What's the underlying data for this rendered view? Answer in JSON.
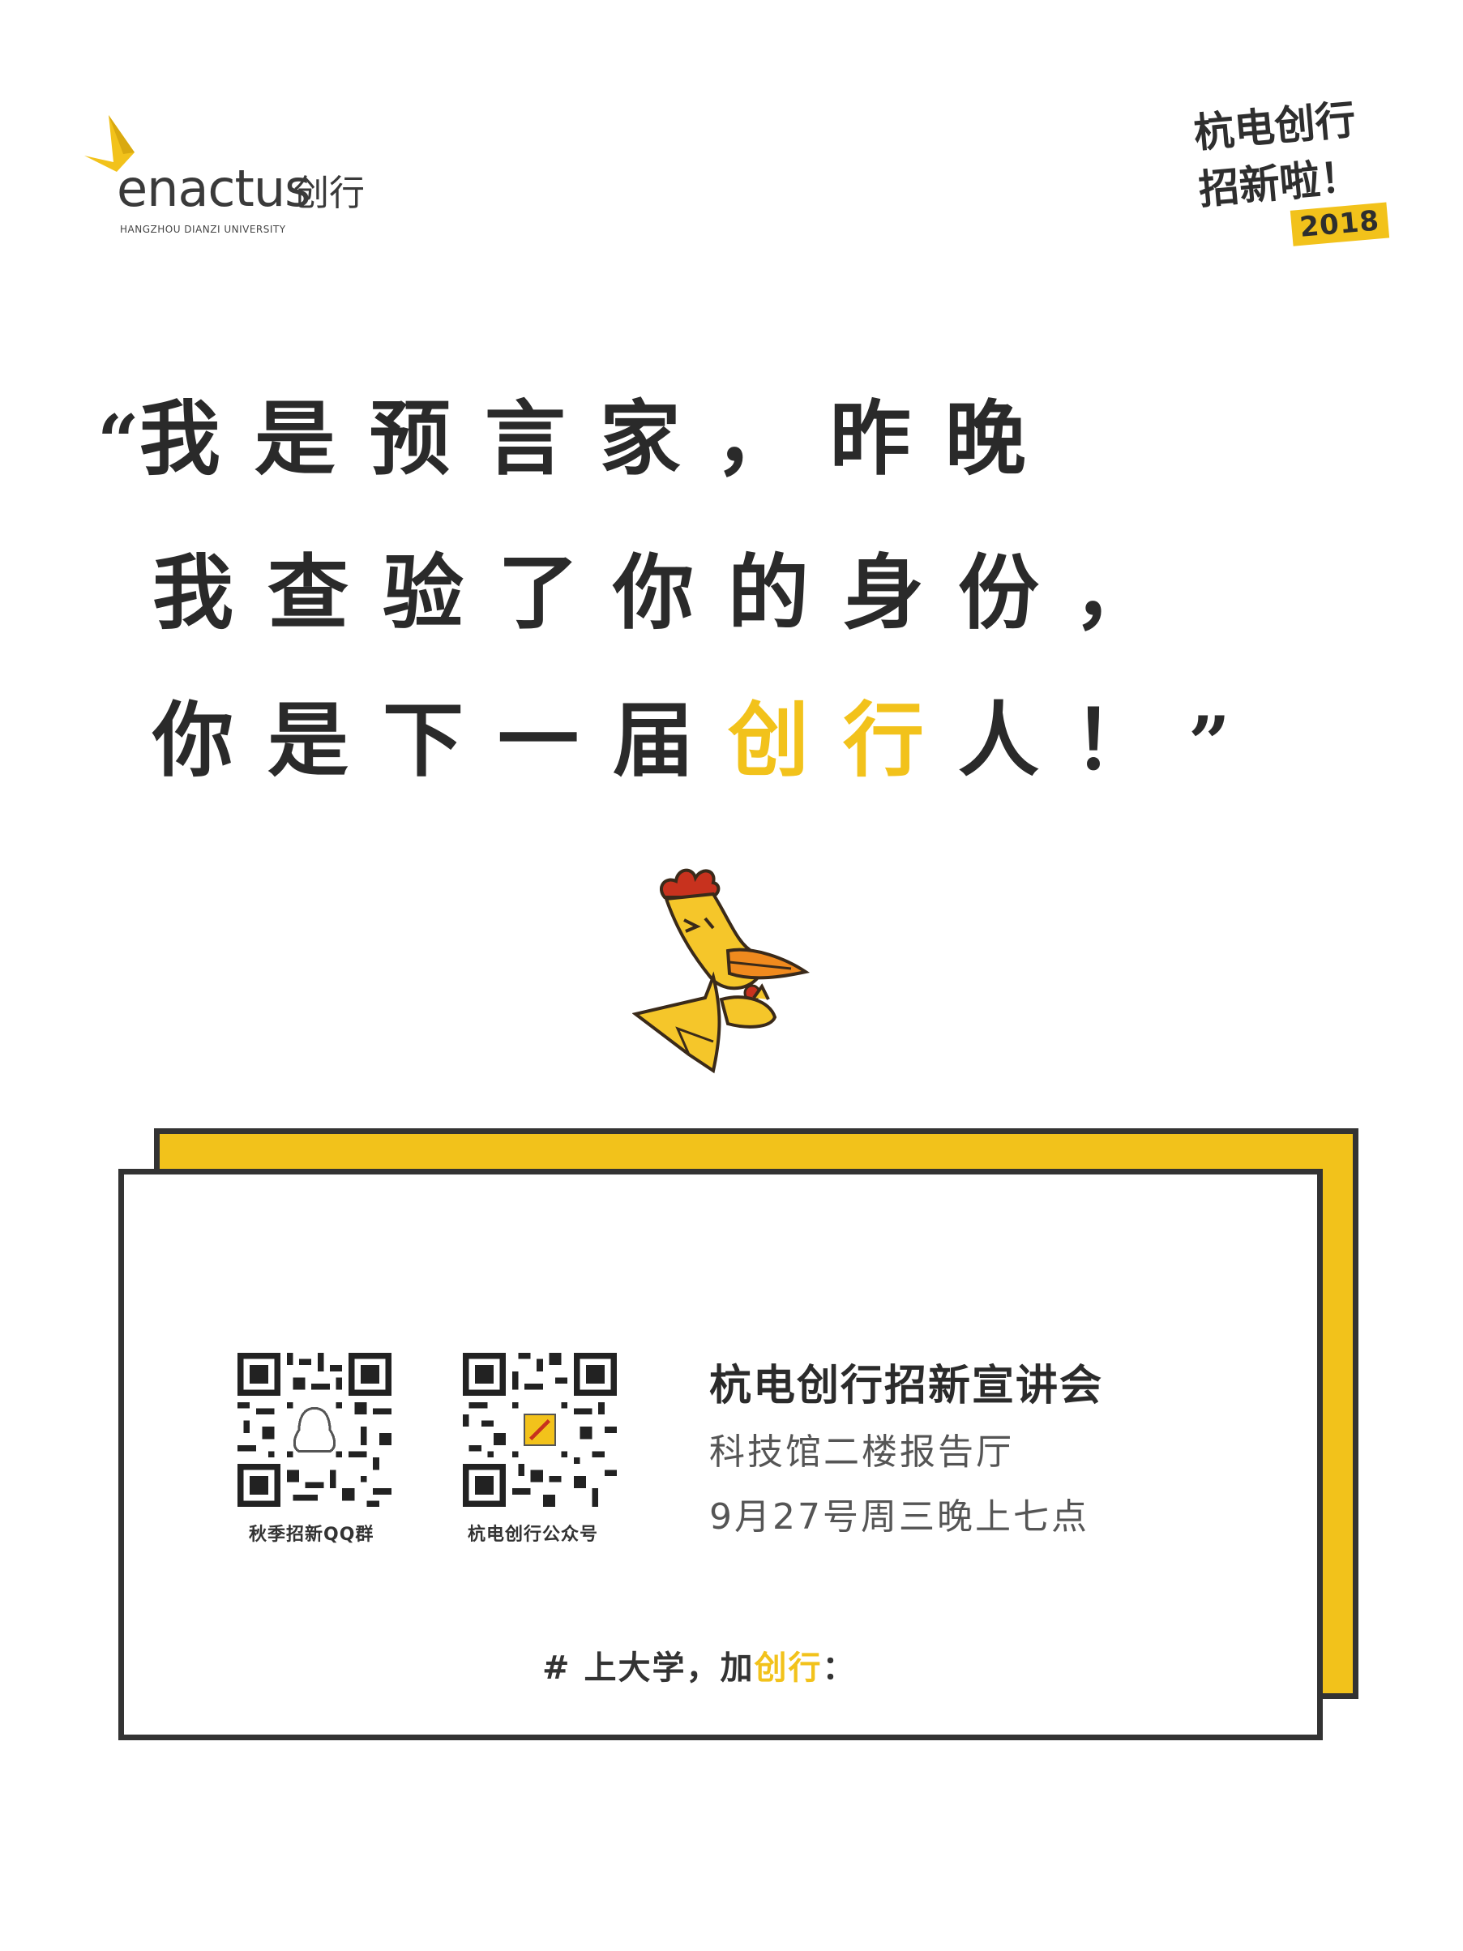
{
  "logo": {
    "wordmark": "enactus",
    "cn_name": "创行",
    "university": "HANGZHOU DIANZI UNIVERSITY"
  },
  "badge": {
    "line1": "杭电创行",
    "line2": "招新啦！",
    "year": "2018"
  },
  "quote": {
    "open_mark": "“",
    "line1_a": "我是预言家，",
    "line1_b": "昨晚",
    "line2": "我查验了你的身份，",
    "line3_a": "你是下一届",
    "line3_highlight": "创行",
    "line3_b": "人！",
    "close_mark": "”"
  },
  "event": {
    "title": "杭电创行招新宣讲会",
    "place": "科技馆二楼报告厅",
    "time": "9月27号周三晚上七点"
  },
  "qr_codes": [
    {
      "caption": "秋季招新QQ群",
      "icon": "qq-penguin-icon"
    },
    {
      "caption": "杭电创行公众号",
      "icon": "enactus-logo-icon"
    }
  ],
  "slogan": {
    "prefix": "# 上大学，加",
    "accent": "创行",
    "suffix": "："
  },
  "colors": {
    "accent": "#f2c21b",
    "text": "#2b2b2b",
    "border": "#333333",
    "chicken_body": "#f5c62a",
    "chicken_comb": "#c8321e"
  }
}
